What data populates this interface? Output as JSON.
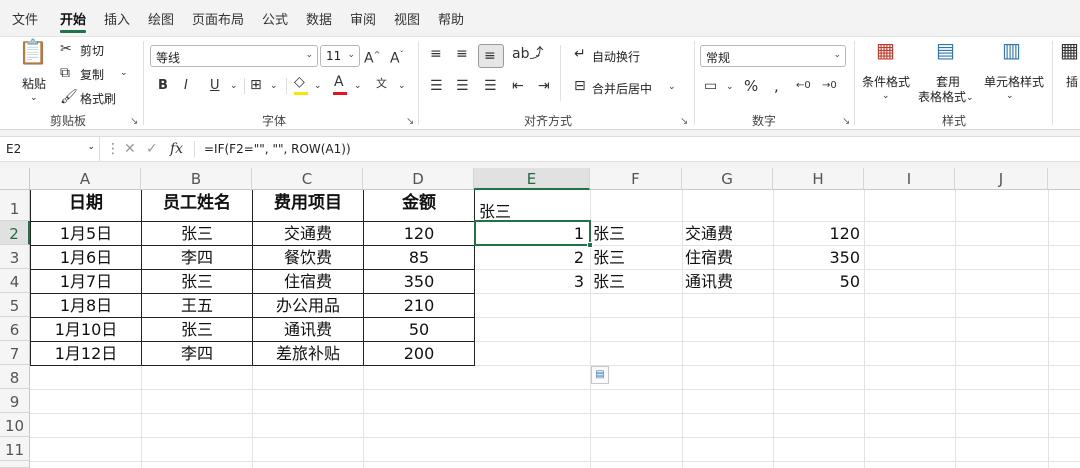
{
  "menu": [
    "文件",
    "开始",
    "插入",
    "绘图",
    "页面布局",
    "公式",
    "数据",
    "审阅",
    "视图",
    "帮助"
  ],
  "clipboard": {
    "paste": "粘贴",
    "cut": "剪切",
    "copy": "复制",
    "format_painter": "格式刷",
    "label": "剪贴板"
  },
  "font": {
    "name": "等线",
    "size": "11",
    "bold": "B",
    "italic": "I",
    "underline": "U",
    "label": "字体"
  },
  "alignment": {
    "wrap": "自动换行",
    "merge": "合并后居中",
    "label": "对齐方式"
  },
  "number": {
    "format": "常规",
    "label": "数字"
  },
  "styles": {
    "conditional": "条件格式",
    "table_1": "套用",
    "table_2": "表格格式",
    "cell_styles": "单元格样式",
    "label": "样式",
    "insert": "插"
  },
  "namebox": "E2",
  "formula": "=IF(F2=\"\", \"\", ROW(A1))",
  "columns": [
    "A",
    "B",
    "C",
    "D",
    "E",
    "F",
    "G",
    "H",
    "I",
    "J"
  ],
  "rows": [
    "1",
    "2",
    "3",
    "4",
    "5",
    "6",
    "7",
    "8",
    "9",
    "10",
    "11"
  ],
  "table": {
    "headers": [
      "日期",
      "员工姓名",
      "费用项目",
      "金额"
    ],
    "rows": [
      [
        "1月5日",
        "张三",
        "交通费",
        "120"
      ],
      [
        "1月6日",
        "李四",
        "餐饮费",
        "85"
      ],
      [
        "1月7日",
        "张三",
        "住宿费",
        "350"
      ],
      [
        "1月8日",
        "王五",
        "办公用品",
        "210"
      ],
      [
        "1月10日",
        "张三",
        "通讯费",
        "50"
      ],
      [
        "1月12日",
        "李四",
        "差旅补贴",
        "200"
      ]
    ]
  },
  "lookup": {
    "e1": "张三",
    "rows": [
      [
        "1",
        "张三",
        "交通费",
        "120"
      ],
      [
        "2",
        "张三",
        "住宿费",
        "350"
      ],
      [
        "3",
        "张三",
        "通讯费",
        "50"
      ]
    ]
  },
  "icons": [
    "paste-icon",
    "cut-icon",
    "copy-icon",
    "format-painter-icon",
    "font-grow-icon",
    "font-shrink-icon",
    "border-icon",
    "fill-color-icon",
    "font-color-icon",
    "phonetic-icon",
    "align-top-icon",
    "align-middle-icon",
    "align-bottom-icon",
    "orientation-icon",
    "align-left-icon",
    "align-center-icon",
    "align-right-icon",
    "indent-decrease-icon",
    "indent-increase-icon",
    "wrap-text-icon",
    "merge-center-icon",
    "currency-icon",
    "percent-icon",
    "comma-icon",
    "increase-decimal-icon",
    "decrease-decimal-icon",
    "conditional-format-icon",
    "table-format-icon",
    "cell-styles-icon",
    "cancel-icon",
    "enter-icon",
    "function-icon",
    "quick-analysis-icon"
  ]
}
